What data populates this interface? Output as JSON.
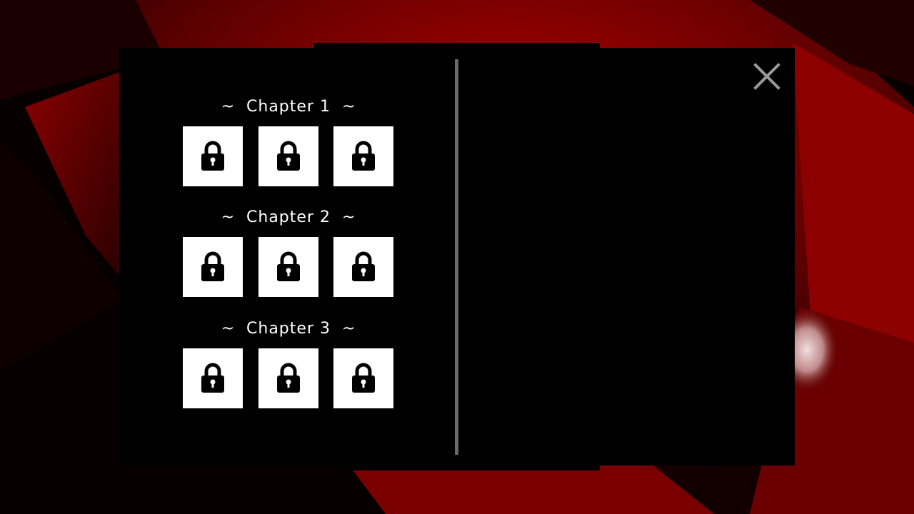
{
  "window": {
    "close_icon": "close-icon"
  },
  "colors": {
    "background_accent": "#a80000",
    "panel": "#000000",
    "divider": "#6a6a6a",
    "slot": "#ffffff",
    "lock": "#000000",
    "close": "#9a9a9a"
  },
  "chapters": [
    {
      "title": "~  Chapter 1  ~",
      "slots": [
        {
          "state": "locked",
          "icon": "lock-icon"
        },
        {
          "state": "locked",
          "icon": "lock-icon"
        },
        {
          "state": "locked",
          "icon": "lock-icon"
        }
      ]
    },
    {
      "title": "~  Chapter 2  ~",
      "slots": [
        {
          "state": "locked",
          "icon": "lock-icon"
        },
        {
          "state": "locked",
          "icon": "lock-icon"
        },
        {
          "state": "locked",
          "icon": "lock-icon"
        }
      ]
    },
    {
      "title": "~  Chapter 3  ~",
      "slots": [
        {
          "state": "locked",
          "icon": "lock-icon"
        },
        {
          "state": "locked",
          "icon": "lock-icon"
        },
        {
          "state": "locked",
          "icon": "lock-icon"
        }
      ]
    }
  ]
}
